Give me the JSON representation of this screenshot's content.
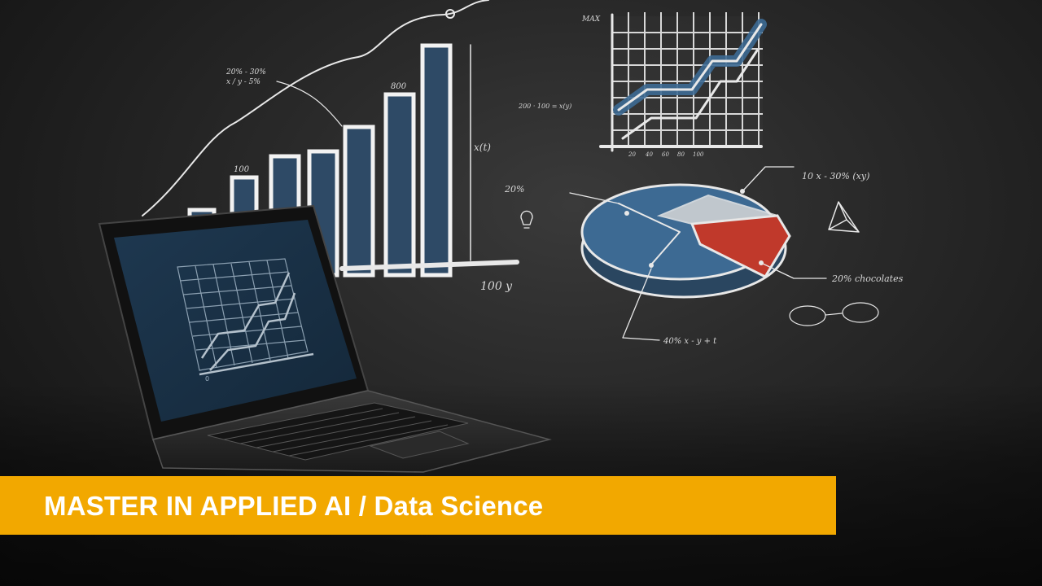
{
  "banner": {
    "title": "MASTER IN APPLIED AI / Data Science"
  },
  "illustration": {
    "bar_labels": [
      "100",
      "800"
    ],
    "bar_axis_label": "x(t)",
    "bar_axis_footer": "100 y",
    "formula_1": "20% - 30%",
    "formula_2": "x / y - 5%",
    "note_1": "200 · 100 = x(y)",
    "pie_note_top": "10 x - 30% (xy)",
    "pie_note_right": "20% chocolates",
    "pie_note_bottom": "40% x - y + t",
    "pie_note_left": "20%",
    "line_chart_axis_top": "MAX",
    "line_chart_ticks": [
      "20",
      "40",
      "60",
      "80",
      "100"
    ],
    "laptop_screen_tick": "0"
  },
  "colors": {
    "banner": "#f2a800",
    "bar_fill": "#2e4a66",
    "pie_blue": "#3d6a93",
    "pie_red": "#c0392b",
    "background": "#2a2a2a"
  }
}
